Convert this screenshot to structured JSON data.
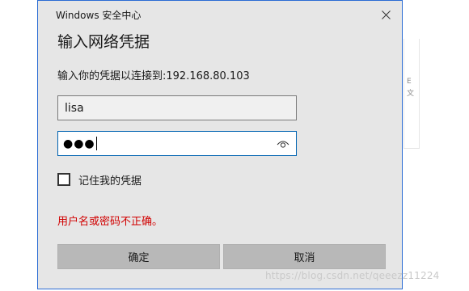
{
  "window": {
    "title": "Windows 安全中心"
  },
  "dialog": {
    "heading": "输入网络凭据",
    "connect_text": "输入你的凭据以连接到:192.168.80.103",
    "username_value": "lisa",
    "password_mask": "●●●",
    "remember_label": "记住我的凭据",
    "remember_checked": false,
    "error_text": "用户名或密码不正确。",
    "ok_label": "确定",
    "cancel_label": "取消"
  },
  "background": {
    "glyph_1": "E",
    "glyph_2": "文"
  },
  "watermark": {
    "text": "https://blog.csdn.net/qeeezz11224"
  },
  "colors": {
    "dialog_bg": "#e6e6e6",
    "border_accent": "#2b6cd4",
    "focus_border": "#0063b1",
    "error": "#d10000",
    "button_bg": "#b8b8b8"
  }
}
